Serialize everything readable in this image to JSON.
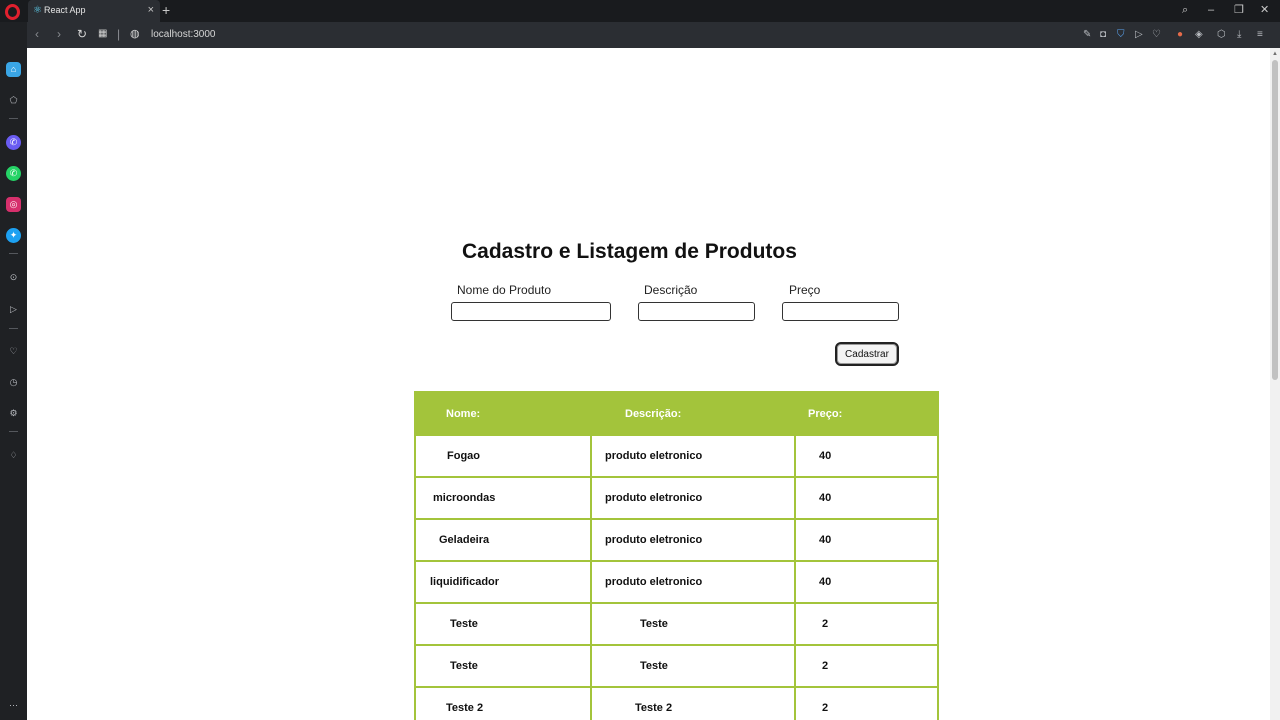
{
  "browser": {
    "tab_title": "React App",
    "url": "localhost:3000",
    "new_tab_label": "+",
    "tab_close_label": "×"
  },
  "page": {
    "title": "Cadastro e Listagem de Produtos",
    "form": {
      "name_label": "Nome do Produto",
      "name_value": "",
      "description_label": "Descrição",
      "description_value": "",
      "price_label": "Preço",
      "price_value": "",
      "submit_label": "Cadastrar"
    },
    "table": {
      "headers": [
        "Nome:",
        "Descrição:",
        "Preço:"
      ],
      "rows": [
        [
          "Fogao",
          "produto eletronico",
          "40"
        ],
        [
          "microondas",
          "produto eletronico",
          "40"
        ],
        [
          "Geladeira",
          "produto eletronico",
          "40"
        ],
        [
          "liquidificador",
          "produto eletronico",
          "40"
        ],
        [
          "Teste",
          "Teste",
          "2"
        ],
        [
          "Teste",
          "Teste",
          "2"
        ],
        [
          "Teste 2",
          "Teste 2",
          "2"
        ]
      ]
    }
  },
  "colors": {
    "table_accent": "#a3c43b",
    "browser_chrome": "#2b2e33",
    "opera_red": "#e0202e"
  },
  "icons": {
    "sidebar": [
      "home-icon",
      "speed-dial-icon",
      "messenger-icon",
      "whatsapp-icon",
      "instagram-icon",
      "twitter-icon",
      "player-icon",
      "send-icon",
      "heart-icon",
      "history-icon",
      "settings-icon",
      "pinboard-icon",
      "more-icon"
    ]
  }
}
